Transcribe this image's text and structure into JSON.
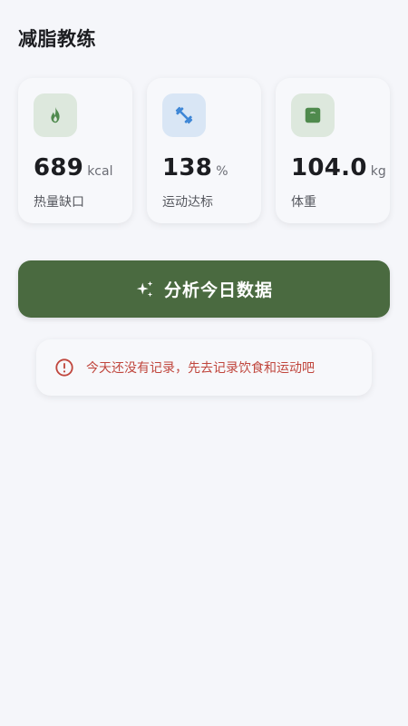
{
  "header": {
    "title": "减脂教练"
  },
  "stats": [
    {
      "icon": "flame-icon",
      "value": "689",
      "unit": "kcal",
      "label": "热量缺口",
      "icon_color": "#4f8a4d",
      "icon_bg": "#dde8dd"
    },
    {
      "icon": "dumbbell-icon",
      "value": "138",
      "unit": "%",
      "label": "运动达标",
      "icon_color": "#3d86d6",
      "icon_bg": "#d9e6f5"
    },
    {
      "icon": "scale-icon",
      "value": "104.0",
      "unit": "kg",
      "label": "体重",
      "icon_color": "#4f8a4d",
      "icon_bg": "#dde8dd"
    }
  ],
  "actions": {
    "analyze_label": "分析今日数据",
    "analyze_icon": "sparkle-icon",
    "button_color": "#4a6a40"
  },
  "notice": {
    "icon": "alert-circle-icon",
    "text": "今天还没有记录，先去记录饮食和运动吧",
    "color": "#c0463d"
  }
}
